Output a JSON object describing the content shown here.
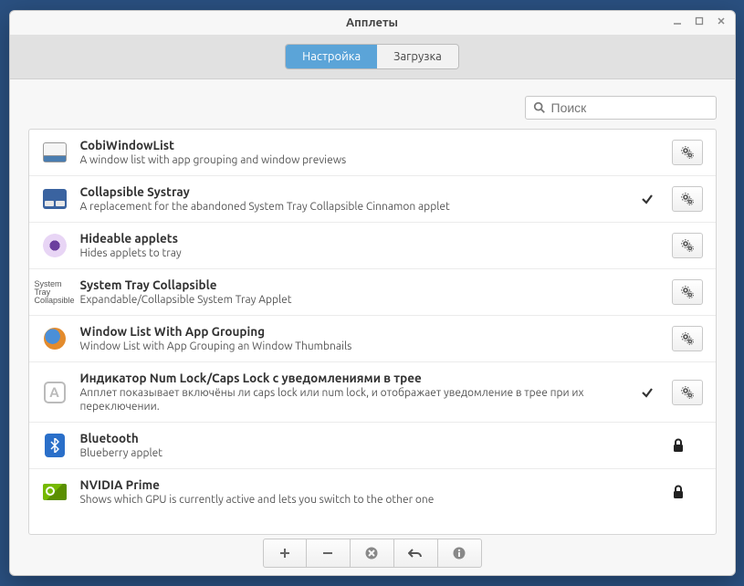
{
  "window": {
    "title": "Апплеты"
  },
  "tabs": {
    "configure": "Настройка",
    "download": "Загрузка"
  },
  "search": {
    "placeholder": "Поиск"
  },
  "applets": [
    {
      "title": "CobiWindowList",
      "desc": "A window list with app grouping and window previews",
      "icon": "cobi",
      "enabled": false,
      "locked": false,
      "configurable": true
    },
    {
      "title": "Collapsible Systray",
      "desc": "A replacement for the abandoned System Tray Collapsible Cinnamon applet",
      "icon": "coll",
      "enabled": true,
      "locked": false,
      "configurable": true
    },
    {
      "title": "Hideable applets",
      "desc": "Hides applets to tray",
      "icon": "eye",
      "enabled": false,
      "locked": false,
      "configurable": true
    },
    {
      "title": "System Tray Collapsible",
      "desc": "Expandable/Collapsible System Tray Applet",
      "icon": "systray",
      "enabled": false,
      "locked": false,
      "configurable": true
    },
    {
      "title": "Window List With App Grouping",
      "desc": "Window List with App Grouping an Window Thumbnails",
      "icon": "ff",
      "enabled": false,
      "locked": false,
      "configurable": true
    },
    {
      "title": "Индикатор Num Lock/Caps Lock с уведомлениями в трее",
      "desc": "Апплет показывает включёны ли caps lock или num lock, и отображает уведомление в трее при их переключении.",
      "icon": "a",
      "enabled": true,
      "locked": false,
      "configurable": true
    },
    {
      "title": "Bluetooth",
      "desc": "Blueberry applet",
      "icon": "bt",
      "enabled": false,
      "locked": true,
      "configurable": false
    },
    {
      "title": "NVIDIA Prime",
      "desc": "Shows which GPU is currently active and lets you switch to the other one",
      "icon": "nv",
      "enabled": false,
      "locked": true,
      "configurable": false
    }
  ],
  "systray_text": "System\nTray\nCollapsible"
}
